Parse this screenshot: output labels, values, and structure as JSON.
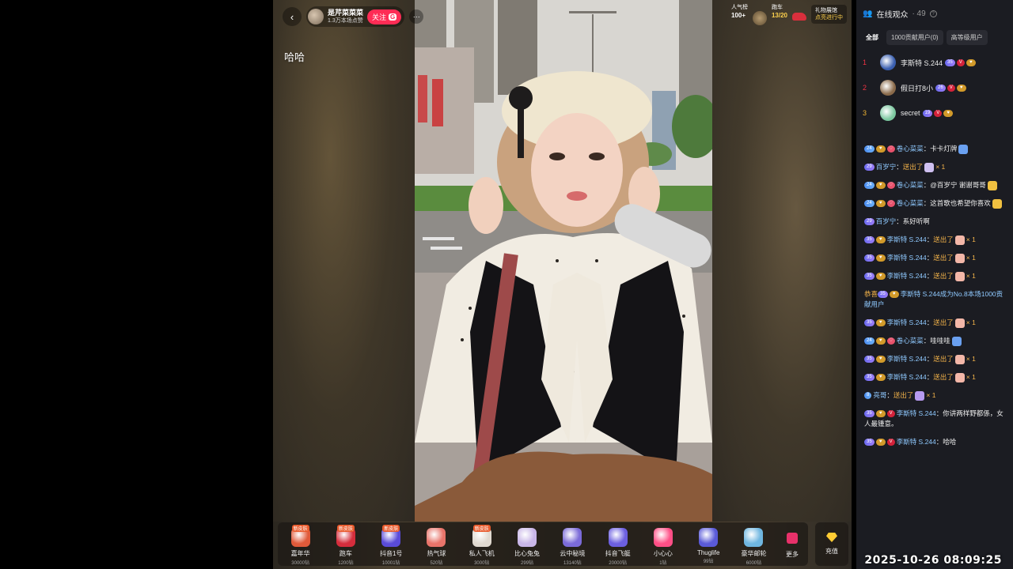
{
  "host": {
    "name": "是芹菜菜菜",
    "likes": "1.3万本场点赞",
    "follow_label": "关注",
    "follow_badge": "G"
  },
  "overlay_text": "哈哈",
  "stats": {
    "popularity_label": "人气榜",
    "popularity_value": "100+",
    "car_label": "跑车",
    "car_value": "13/20",
    "gift_title": "礼物展馆",
    "gift_sub": "点亮进行中"
  },
  "gifts": [
    {
      "name": "嘉年华",
      "price": "30000钻",
      "tag": "新皮肤",
      "color": "#e05a3a"
    },
    {
      "name": "跑车",
      "price": "1200钻",
      "tag": "新皮肤",
      "color": "#d52d3c"
    },
    {
      "name": "抖音1号",
      "price": "10001钻",
      "tag": "新皮肤",
      "color": "#5a4bd8"
    },
    {
      "name": "热气球",
      "price": "520钻",
      "tag": "",
      "color": "#e8746a"
    },
    {
      "name": "私人飞机",
      "price": "3000钻",
      "tag": "新皮肤",
      "color": "#e0d9d0"
    },
    {
      "name": "比心兔兔",
      "price": "299钻",
      "tag": "",
      "color": "#c9b6e8"
    },
    {
      "name": "云中秘境",
      "price": "13140钻",
      "tag": "",
      "color": "#7b6bd8"
    },
    {
      "name": "抖音飞艇",
      "price": "20000钻",
      "tag": "",
      "color": "#6c5fe0"
    },
    {
      "name": "小心心",
      "price": "1钻",
      "tag": "",
      "color": "#ff4f86"
    },
    {
      "name": "Thuglife",
      "price": "99钻",
      "tag": "",
      "color": "#5a5ad8"
    },
    {
      "name": "豪华邮轮",
      "price": "6000钻",
      "tag": "",
      "color": "#6fb6e0"
    }
  ],
  "gift_more_label": "更多",
  "recharge_label": "充值",
  "panel": {
    "title": "在线观众",
    "count": "· 49",
    "tabs": [
      "全部",
      "1000贡献用户(0)",
      "高等级用户"
    ],
    "ranks": [
      {
        "num": "1",
        "name": "李斯特 S.244",
        "level": "35",
        "color": "#3a5fb0"
      },
      {
        "num": "2",
        "name": "假日打8小",
        "level": "26",
        "color": "#8a6a4a"
      },
      {
        "num": "3",
        "name": "secret",
        "level": "19",
        "color": "#7cc8a0"
      }
    ]
  },
  "chat": [
    {
      "lvl": "24",
      "lvlclass": "b-lvl2",
      "fan": true,
      "fan2": true,
      "who": "卷心菜菜",
      "text": "卡卡灯牌",
      "gift": "#6aa0f0"
    },
    {
      "lvl": "29",
      "lvlclass": "b-lvl",
      "who": "百岁宁",
      "action": "送出了",
      "gift": "#cfc0f0",
      "times": "× 1"
    },
    {
      "lvl": "24",
      "lvlclass": "b-lvl2",
      "fan": true,
      "fan2": true,
      "who": "卷心菜菜",
      "text": "@百岁宁 谢谢哥哥",
      "gift": "#f0c040"
    },
    {
      "lvl": "24",
      "lvlclass": "b-lvl2",
      "fan": true,
      "fan2": true,
      "who": "卷心菜菜",
      "text": "这首歌也希望你喜欢",
      "gift": "#f0c040"
    },
    {
      "lvl": "29",
      "lvlclass": "b-lvl",
      "who": "百岁宁",
      "text": "系好听啊"
    },
    {
      "lvl": "35",
      "lvlclass": "b-lvl",
      "fan": true,
      "who": "李斯特 S.244",
      "action": "送出了",
      "gift": "#f3b7a8",
      "times": "× 1"
    },
    {
      "lvl": "35",
      "lvlclass": "b-lvl",
      "fan": true,
      "who": "李斯特 S.244",
      "action": "送出了",
      "gift": "#f3b7a8",
      "times": "× 1"
    },
    {
      "lvl": "35",
      "lvlclass": "b-lvl",
      "fan": true,
      "who": "李斯特 S.244",
      "action": "送出了",
      "gift": "#f3b7a8",
      "times": "× 1"
    },
    {
      "sys": "恭喜",
      "lvl": "35",
      "lvlclass": "b-lvl",
      "fan": true,
      "who": "李斯特 S.244成为No.8本场1000贡献用户"
    },
    {
      "lvl": "35",
      "lvlclass": "b-lvl",
      "fan": true,
      "who": "李斯特 S.244",
      "action": "送出了",
      "gift": "#f3b7a8",
      "times": "× 1"
    },
    {
      "lvl": "24",
      "lvlclass": "b-lvl2",
      "fan": true,
      "fan2": true,
      "who": "卷心菜菜",
      "text": "哇哇哇",
      "gift": "#6aa0f0"
    },
    {
      "lvl": "35",
      "lvlclass": "b-lvl",
      "fan": true,
      "who": "李斯特 S.244",
      "action": "送出了",
      "gift": "#f3b7a8",
      "times": "× 1"
    },
    {
      "lvl": "35",
      "lvlclass": "b-lvl",
      "fan": true,
      "who": "李斯特 S.244",
      "action": "送出了",
      "gift": "#f3b7a8",
      "times": "× 1"
    },
    {
      "lvl": "8",
      "lvlclass": "b-lvl2",
      "who": "亮哥",
      "action": "送出了",
      "gift": "#b79af0",
      "times": "× 1"
    },
    {
      "lvl": "35",
      "lvlclass": "b-lvl",
      "fan": true,
      "v": true,
      "who": "李斯特 S.244",
      "text": "你讲两样野都係，女人最锺意。"
    },
    {
      "lvl": "35",
      "lvlclass": "b-lvl",
      "fan": true,
      "v": true,
      "who": "李斯特 S.244",
      "text": "哈哈"
    }
  ],
  "clock": "2025-10-26 08:09:25"
}
